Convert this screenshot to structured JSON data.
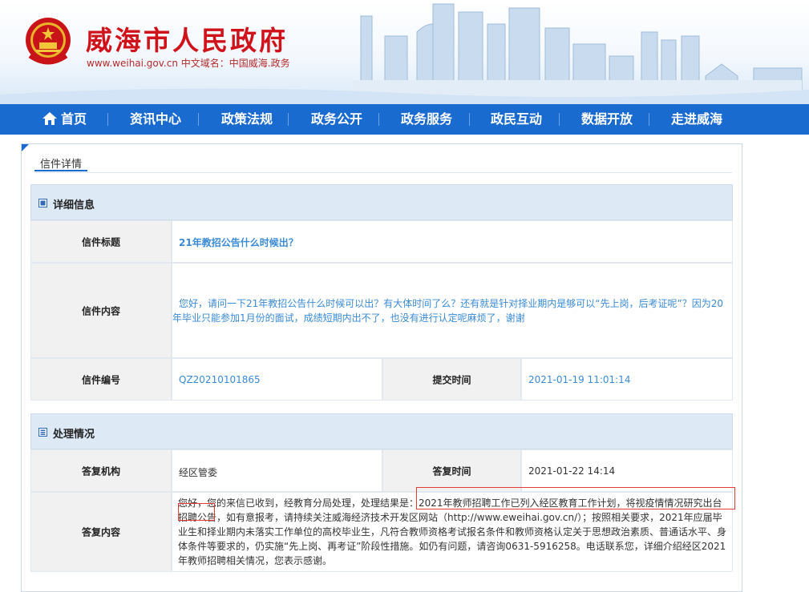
{
  "header": {
    "site_title": "威海市人民政府",
    "site_url_line": "www.weihai.gov.cn 中文域名：中国威海.政务"
  },
  "nav": {
    "items": [
      "首页",
      "资讯中心",
      "政策法规",
      "政务公开",
      "政务服务",
      "政民互动",
      "数据开放",
      "走进威海"
    ]
  },
  "tab": {
    "label": "信件详情"
  },
  "details": {
    "section_title": "详细信息",
    "subject_label": "信件标题",
    "subject_value": "21年教招公告什么时候出？",
    "content_label": "信件内容",
    "content_value": "您好，请问一下21年教招公告什么时候可以出？有大体时间了么？还有就是针对择业期内是够可以“先上岗，后考证呢”？因为20年毕业只能参加1月份的面试，成绩短期内出不了，也没有进行认定呢麻烦了，谢谢",
    "number_label": "信件编号",
    "number_value": "QZ20210101865",
    "submit_time_label": "提交时间",
    "submit_time_value": "2021-01-19 11:01:14"
  },
  "handling": {
    "section_title": "处理情况",
    "org_label": "答复机构",
    "org_value": "经区管委",
    "reply_time_label": "答复时间",
    "reply_time_value": "2021-01-22 14:14",
    "reply_label": "答复内容",
    "reply_value": "您好，您的来信已收到，经教育分局处理，处理结果是：2021年教师招聘工作已列入经区教育工作计划，将视疫情情况研究出台招聘公告，如有意报考，请持续关注威海经济技术开发区网站（http://www.eweihai.gov.cn/）；按照相关要求，2021年应届毕业生和择业期内未落实工作单位的高校毕业生，凡符合教师资格考试报名条件和教师资格认定关于思想政治素质、普通话水平、身体条件等要求的，仍实施“先上岗、再考证”阶段性措施。如仍有问题，请咨询0631-5916258。电话联系您，详细介绍经区2021年教师招聘相关情况，您表示感谢。"
  },
  "colors": {
    "nav": "#1a6bd0",
    "title_red": "#d0121b",
    "link_blue": "#3a8ad6",
    "highlight": "#e53935"
  }
}
